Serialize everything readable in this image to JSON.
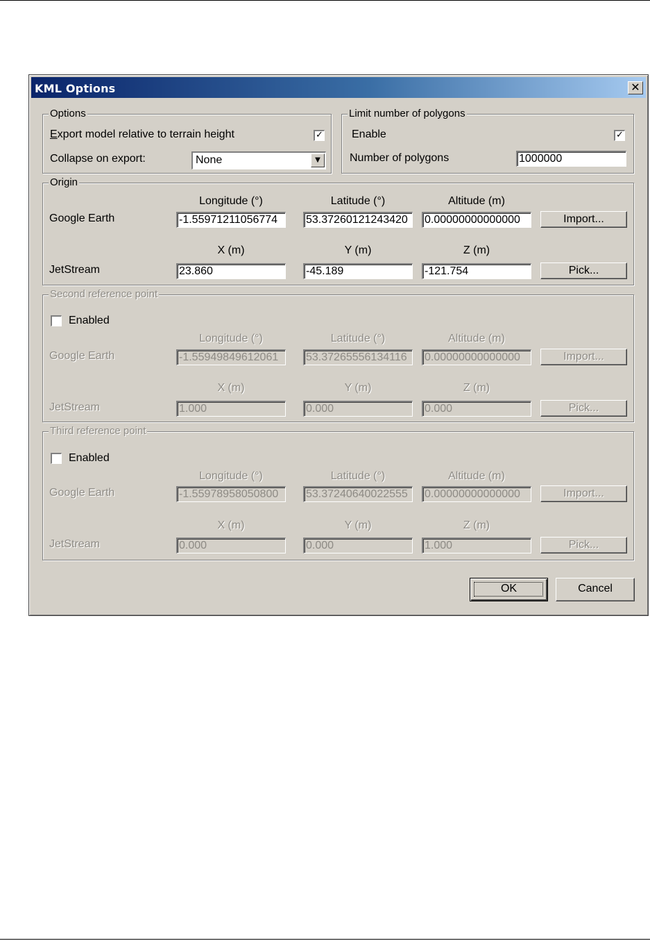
{
  "dialog": {
    "title": "KML Options",
    "close_glyph": "✕",
    "close_icon": "close-icon"
  },
  "options": {
    "legend": "Options",
    "export_relative_label_key": "E",
    "export_relative_label_rest": "xport model relative to terrain height",
    "export_relative_checked": true,
    "collapse_label": "Collapse on export:",
    "collapse_value": "None",
    "collapse_arrow_icon": "chevron-down-icon"
  },
  "limit": {
    "legend": "Limit number of polygons",
    "enable_label": "Enable",
    "enable_checked": true,
    "num_label": "Number of polygons",
    "num_value": "1000000"
  },
  "col_headers": {
    "longitude": "Longitude (°)",
    "latitude": "Latitude (°)",
    "altitude": "Altitude (m)",
    "x": "X (m)",
    "y": "Y (m)",
    "z": "Z (m)"
  },
  "row_labels": {
    "google_earth": "Google Earth",
    "jetstream": "JetStream"
  },
  "origin": {
    "legend": "Origin",
    "longitude": "-1.55971211056774",
    "latitude": "53.37260121243420",
    "altitude": "0.00000000000000",
    "x": "23.860",
    "y": "-45.189",
    "z": "-121.754",
    "import_label": "Import...",
    "pick_label": "Pick..."
  },
  "second": {
    "legend": "Second reference point",
    "enabled_label": "Enabled",
    "enabled_checked": false,
    "longitude": "-1.55949849612061",
    "latitude": "53.37265556134116",
    "altitude": "0.00000000000000",
    "x": "1.000",
    "y": "0.000",
    "z": "0.000",
    "import_label": "Import...",
    "pick_label": "Pick..."
  },
  "third": {
    "legend": "Third reference point",
    "enabled_label": "Enabled",
    "enabled_checked": false,
    "longitude": "-1.55978958050800",
    "latitude": "53.37240640022555",
    "altitude": "0.00000000000000",
    "x": "0.000",
    "y": "0.000",
    "z": "1.000",
    "import_label": "Import...",
    "pick_label": "Pick..."
  },
  "footer": {
    "ok_label": "OK",
    "cancel_label": "Cancel"
  }
}
